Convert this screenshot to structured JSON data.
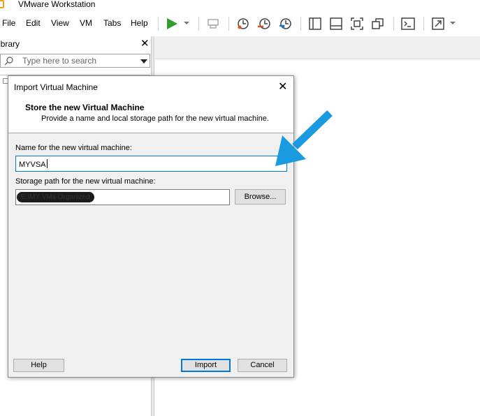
{
  "app": {
    "title": "VMware Workstation"
  },
  "menu": {
    "items": [
      "File",
      "Edit",
      "View",
      "VM",
      "Tabs",
      "Help"
    ]
  },
  "toolbar": {
    "icons": [
      "play-icon",
      "snapshot-icon",
      "revert-snapshot-icon",
      "snapshot-manager-icon",
      "library-view-icon",
      "thumbnail-bar-icon",
      "fullscreen-icon",
      "unity-icon",
      "console-icon",
      "stretch-icon"
    ]
  },
  "library": {
    "title": "ibrary",
    "search_placeholder": "Type here to search"
  },
  "dialog": {
    "title": "Import Virtual Machine",
    "heading": "Store the new Virtual Machine",
    "subheading": "Provide a name and local storage path for the new virtual machine.",
    "name_label": "Name for the new virtual machine:",
    "name_value": "MYVSA",
    "path_label": "Storage path for the new virtual machine:",
    "path_value": "E:\\MY VMs Organized",
    "browse_label": "Browse...",
    "help_label": "Help",
    "import_label": "Import",
    "cancel_label": "Cancel"
  },
  "colors": {
    "accent": "#0078d7",
    "annotation_arrow": "#1a9ae0",
    "play_green": "#2e9e2e"
  }
}
